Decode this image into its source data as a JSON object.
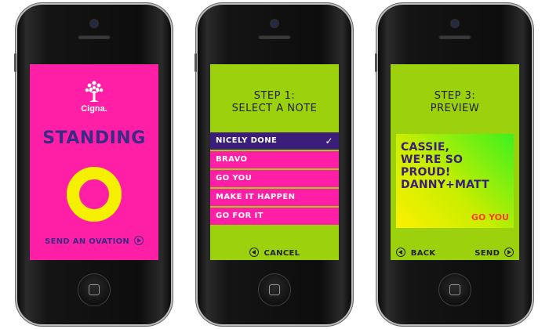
{
  "colors": {
    "pink": "#ff1fa6",
    "lime": "#9bd10d",
    "purple": "#3b1e7a",
    "yellow": "#f4f000",
    "orange_red": "#ff3b1f"
  },
  "screen1": {
    "logo_text": "Cigna.",
    "headline": "STANDING",
    "action_label": "SEND AN OVATION",
    "icons": [
      "cigna-tree-logo",
      "ring-shape",
      "arrow-right-circle-icon"
    ]
  },
  "screen2": {
    "step_line1": "STEP 1:",
    "step_line2": "SELECT A NOTE",
    "notes": [
      {
        "label": "NICELY DONE",
        "selected": true
      },
      {
        "label": "BRAVO",
        "selected": false
      },
      {
        "label": "GO YOU",
        "selected": false
      },
      {
        "label": "MAKE IT HAPPEN",
        "selected": false
      },
      {
        "label": "GO FOR IT",
        "selected": false
      }
    ],
    "check_mark": "✓",
    "cancel_label": "CANCEL"
  },
  "screen3": {
    "step_line1": "STEP 3:",
    "step_line2": "PREVIEW",
    "message_lines": [
      "CASSIE,",
      "WE’RE SO",
      "PROUD!",
      "DANNY+MATT"
    ],
    "card_tag": "GO YOU",
    "back_label": "BACK",
    "send_label": "SEND"
  }
}
